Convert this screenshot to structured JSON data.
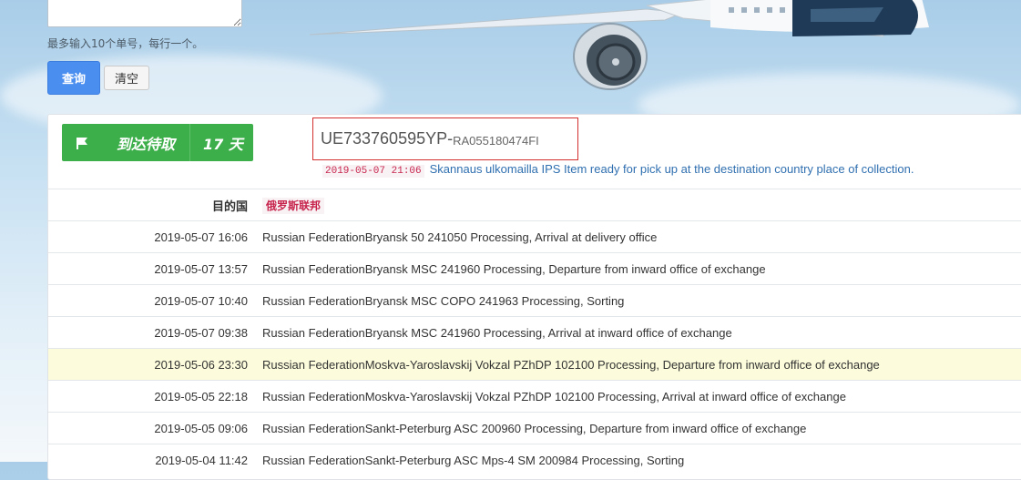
{
  "form": {
    "hint": "最多输入10个单号，每行一个。",
    "query_label": "查询",
    "clear_label": "清空"
  },
  "colors": {
    "accent": "#4a8ef0",
    "status_green": "#3daf4a",
    "tracking_border": "#d32f2f",
    "highlight_row": "#fcfcdc"
  },
  "summary": {
    "status_icon": "flag-icon",
    "status_text": "到达待取",
    "days": "17 天",
    "tracking_number": "UE733760595YP-",
    "linked_number": "RA055180474FI",
    "latest_time": "2019-05-07 21:06",
    "latest_text": "Skannaus ulkomailla IPS Item ready for pick up at the destination country place of collection."
  },
  "destination": {
    "label": "目的国",
    "value": "俄罗斯联邦"
  },
  "events": [
    {
      "time": "2019-05-07 16:06",
      "text": "Russian FederationBryansk 50 241050 Processing, Arrival at delivery office"
    },
    {
      "time": "2019-05-07 13:57",
      "text": "Russian FederationBryansk MSC 241960 Processing, Departure from inward office of exchange"
    },
    {
      "time": "2019-05-07 10:40",
      "text": "Russian FederationBryansk MSC COPO 241963 Processing, Sorting"
    },
    {
      "time": "2019-05-07 09:38",
      "text": "Russian FederationBryansk MSC 241960 Processing, Arrival at inward office of exchange"
    },
    {
      "time": "2019-05-06 23:30",
      "text": "Russian FederationMoskva-Yaroslavskij Vokzal PZhDP 102100 Processing, Departure from inward office of exchange"
    },
    {
      "time": "2019-05-05 22:18",
      "text": "Russian FederationMoskva-Yaroslavskij Vokzal PZhDP 102100 Processing, Arrival at inward office of exchange"
    },
    {
      "time": "2019-05-05 09:06",
      "text": "Russian FederationSankt-Peterburg ASC 200960 Processing, Departure from inward office of exchange"
    },
    {
      "time": "2019-05-04 11:42",
      "text": "Russian FederationSankt-Peterburg ASC Mps-4 SM 200984 Processing, Sorting"
    }
  ]
}
